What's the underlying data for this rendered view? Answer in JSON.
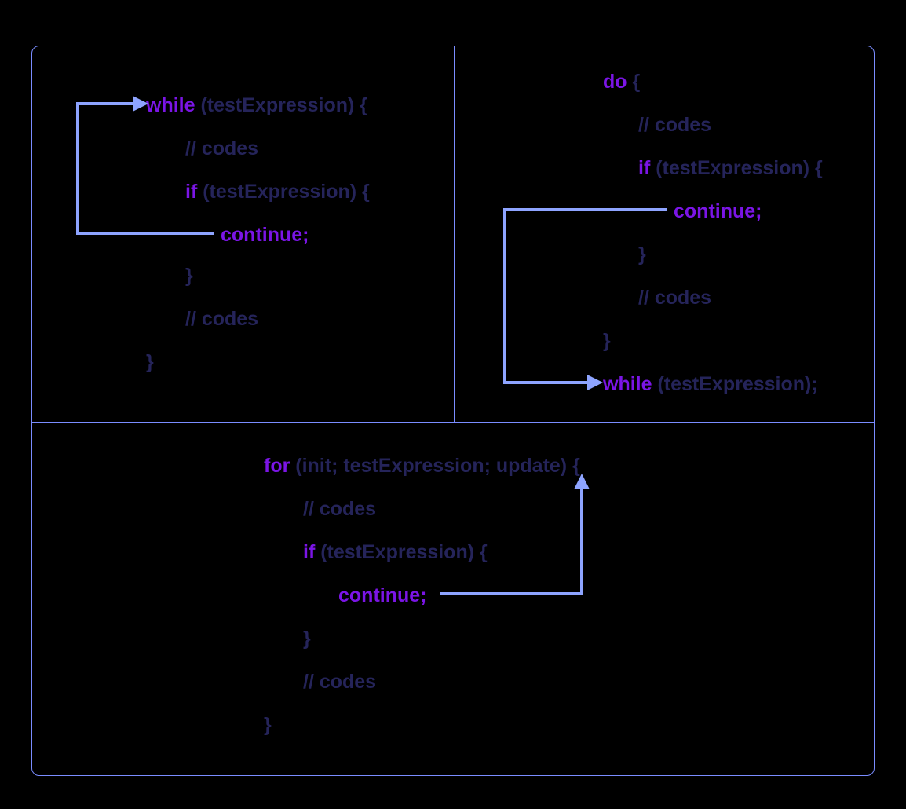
{
  "colors": {
    "keyword": "#7b15e6",
    "text": "#25245a",
    "arrow": "#8ea4ff",
    "border": "#7a8cff",
    "background": "#000000"
  },
  "while": {
    "l1_kw": "while",
    "l1_tx": " (testExpression) {",
    "l2": "// codes",
    "l3_kw": "if",
    "l3_tx": " (testExpression) {",
    "l4": "continue;",
    "l5": "}",
    "l6": "// codes",
    "l7": "}"
  },
  "do": {
    "l1_kw": "do",
    "l1_tx": " {",
    "l2": "// codes",
    "l3_kw": "if",
    "l3_tx": " (testExpression) {",
    "l4": "continue;",
    "l5": "}",
    "l6": "// codes",
    "l7": "}",
    "l8_kw": "while",
    "l8_tx": " (testExpression);"
  },
  "for": {
    "l1_kw": "for",
    "l1_tx": " (init; testExpression; update) {",
    "l2": "// codes",
    "l3_kw": "if",
    "l3_tx": " (testExpression) {",
    "l4": "continue;",
    "l5": "}",
    "l6": "// codes",
    "l7": "}"
  }
}
